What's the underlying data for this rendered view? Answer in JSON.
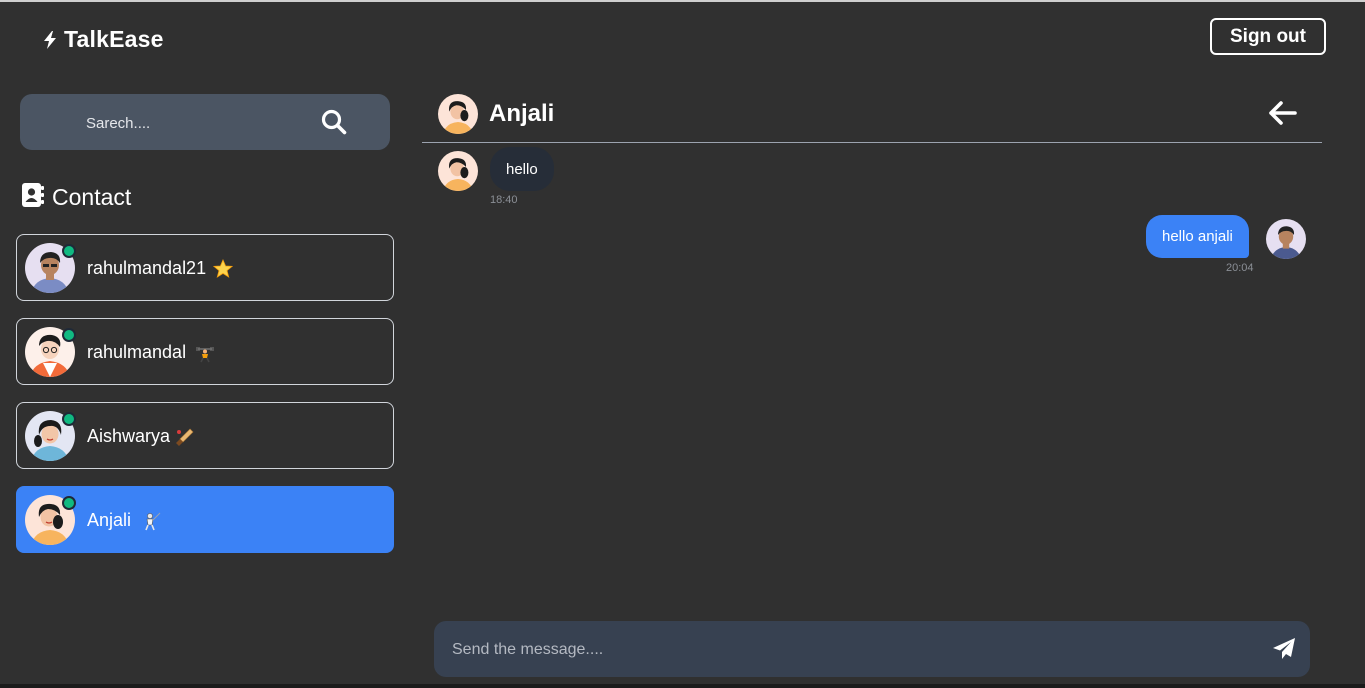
{
  "app": {
    "name": "TalkEase",
    "brand_icon": "bolt-icon"
  },
  "header": {
    "signout_label": "Sign out"
  },
  "search": {
    "placeholder": "Sarech....",
    "icon": "search-icon"
  },
  "contacts_section": {
    "title": "Contact",
    "icon": "address-book-icon"
  },
  "contacts": [
    {
      "name": "rahulmandal21",
      "emoji": "star",
      "online": true,
      "active": false
    },
    {
      "name": "rahulmandal",
      "emoji": "weightlifting",
      "online": true,
      "active": false
    },
    {
      "name": "Aishwarya",
      "emoji": "cricket-bat",
      "online": true,
      "active": false
    },
    {
      "name": "Anjali",
      "emoji": "fencing",
      "online": true,
      "active": true
    }
  ],
  "chat": {
    "contact_name": "Anjali",
    "back_icon": "arrow-left-icon",
    "messages": [
      {
        "direction": "incoming",
        "text": "hello",
        "time": "18:40"
      },
      {
        "direction": "outgoing",
        "text": "hello anjali",
        "time": "20:04"
      }
    ]
  },
  "composer": {
    "placeholder": "Send the message....",
    "send_icon": "paper-plane-icon"
  },
  "colors": {
    "background": "#303030",
    "accent": "#3b82f6",
    "online": "#10b981",
    "search_bg": "#4b5563",
    "composer_bg": "#374151",
    "incoming_bubble": "#262d38"
  }
}
